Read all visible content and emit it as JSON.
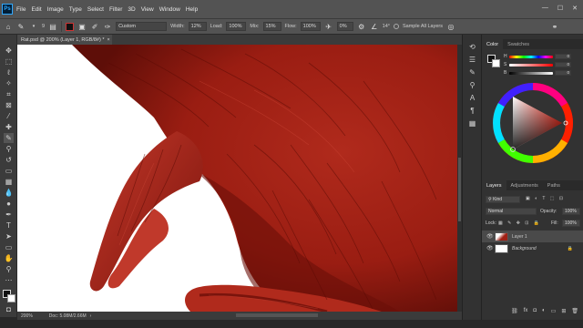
{
  "app": {
    "logo_text": "Ps"
  },
  "menu": [
    "File",
    "Edit",
    "Image",
    "Type",
    "Select",
    "Filter",
    "3D",
    "View",
    "Window",
    "Help"
  ],
  "window_controls": {
    "minimize": "—",
    "maximize": "☐",
    "close": "✕"
  },
  "options": {
    "brush_size": "9",
    "mode_value": "Custom",
    "width_label": "Width:",
    "width_value": "12%",
    "load_label": "Load:",
    "load_value": "100%",
    "mix_label": "Mix:",
    "mix_value": "15%",
    "flow_label": "Flow:",
    "flow_value": "100%",
    "angle_value": "0%",
    "rotation_value": "14°",
    "sample_label": "Sample All Layers"
  },
  "document": {
    "tab_title": "Rat.psd @ 200% (Layer 1, RGB/8#) *"
  },
  "status": {
    "zoom": "200%",
    "doc_info": "Doc: 5.08M/2.66M"
  },
  "color_panel": {
    "tabs": [
      "Color",
      "Swatches"
    ],
    "h_label": "H",
    "h_value": "0",
    "s_label": "S",
    "s_value": "0",
    "b_label": "B",
    "b_value": "0"
  },
  "layers_panel": {
    "tabs": [
      "Layers",
      "Adjustments",
      "Paths"
    ],
    "filter_kind": "Kind",
    "blend_mode": "Normal",
    "opacity_label": "Opacity:",
    "opacity_value": "100%",
    "lock_label": "Lock:",
    "fill_label": "Fill:",
    "fill_value": "100%",
    "layers": [
      {
        "name": "Layer 1"
      },
      {
        "name": "Background"
      }
    ]
  },
  "colors": {
    "accent_red": "#b52a1c",
    "dark_red": "#6e0f08",
    "panel_bg": "#323232",
    "ps_blue": "#31a8ff"
  }
}
